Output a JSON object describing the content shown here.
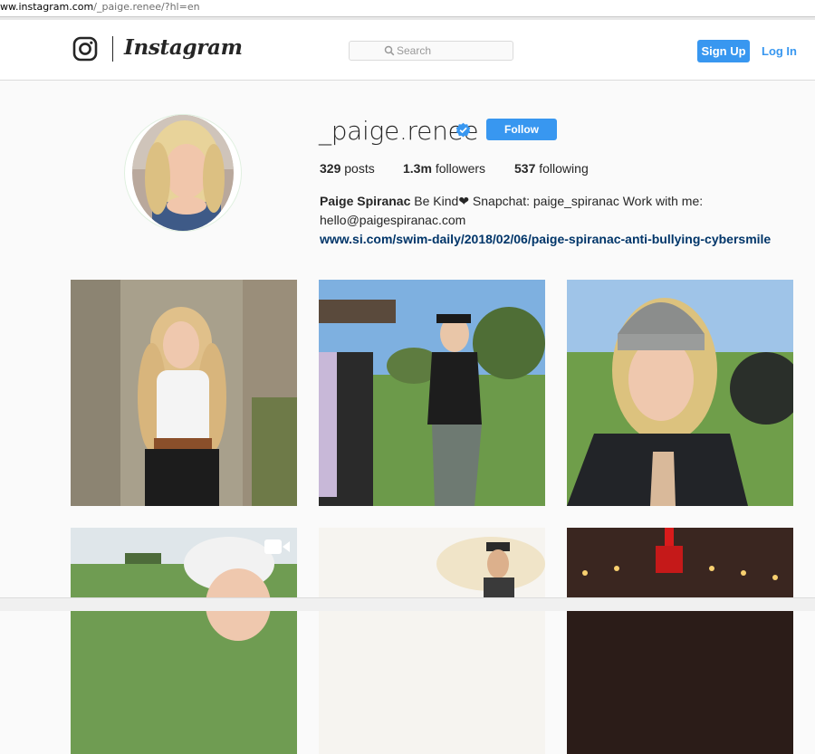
{
  "browser": {
    "url_host": "ww.instagram.com",
    "url_path": "/_paige.renee/?hl=en"
  },
  "nav": {
    "brand": "Instagram",
    "search_placeholder": "Search",
    "signup_label": "Sign Up",
    "login_label": "Log In"
  },
  "profile": {
    "username": "_paige.renee",
    "follow_label": "Follow",
    "posts_count": "329",
    "posts_label": "posts",
    "followers_count": "1.3m",
    "followers_label": "followers",
    "following_count": "537",
    "following_label": "following",
    "full_name": "Paige Spiranac",
    "bio_line1": " Be Kind❤ Snapchat: paige_spiranac Work with me:",
    "bio_line2": "hello@paigespiranac.com",
    "website": "www.si.com/swim-daily/2018/02/06/paige-spiranac-anti-bullying-cybersmile"
  },
  "colors": {
    "accent": "#3897f0",
    "link": "#003569",
    "text": "#262626",
    "background": "#fafafa"
  },
  "icons": {
    "logo": "instagram-camera-icon",
    "search": "search-icon",
    "verified": "verified-badge-icon",
    "video": "video-camera-icon"
  }
}
